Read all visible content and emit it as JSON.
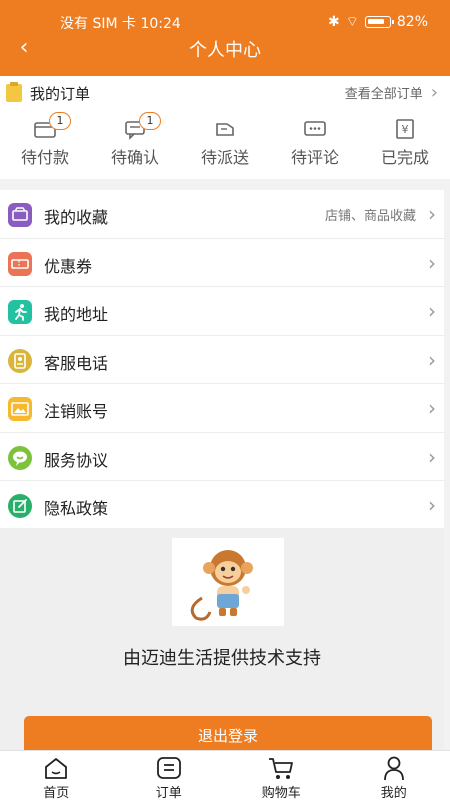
{
  "status_bar": {
    "carrier_time": "没有 SIM 卡 10:24",
    "battery": "82%"
  },
  "header": {
    "title": "个人中心"
  },
  "orders": {
    "title": "我的订单",
    "view_all": "查看全部订单",
    "tabs": [
      {
        "label": "待付款",
        "badge": "1",
        "icon": "wallet-icon"
      },
      {
        "label": "待确认",
        "badge": "1",
        "icon": "chat-card-icon"
      },
      {
        "label": "待派送",
        "badge": "",
        "icon": "delivery-box-icon"
      },
      {
        "label": "待评论",
        "badge": "",
        "icon": "comment-icon"
      },
      {
        "label": "已完成",
        "badge": "",
        "icon": "yen-receipt-icon"
      }
    ]
  },
  "menu": [
    {
      "label": "我的收藏",
      "extra": "店铺、商品收藏",
      "icon": "favorites-icon",
      "color": "#8a5bc0"
    },
    {
      "label": "优惠券",
      "extra": "",
      "icon": "coupon-icon",
      "color": "#ea7455"
    },
    {
      "label": "我的地址",
      "extra": "",
      "icon": "runner-icon",
      "color": "#22c1a0"
    },
    {
      "label": "客服电话",
      "extra": "",
      "icon": "phone-card-icon",
      "color": "#d9b63a"
    },
    {
      "label": "注销账号",
      "extra": "",
      "icon": "image-icon",
      "color": "#f5b82e"
    },
    {
      "label": "服务协议",
      "extra": "",
      "icon": "smile-chat-icon",
      "color": "#7cc23a"
    },
    {
      "label": "隐私政策",
      "extra": "",
      "icon": "edit-icon",
      "color": "#28b06a"
    }
  ],
  "footer": {
    "support_text": "由迈迪生活提供技术支持",
    "logout": "退出登录"
  },
  "tabbar": [
    {
      "label": "首页",
      "icon": "home-icon"
    },
    {
      "label": "订单",
      "icon": "list-icon"
    },
    {
      "label": "购物车",
      "icon": "cart-icon"
    },
    {
      "label": "我的",
      "icon": "user-icon"
    }
  ],
  "colors": {
    "accent": "#ee7d22",
    "background": "#f2f2f2"
  }
}
